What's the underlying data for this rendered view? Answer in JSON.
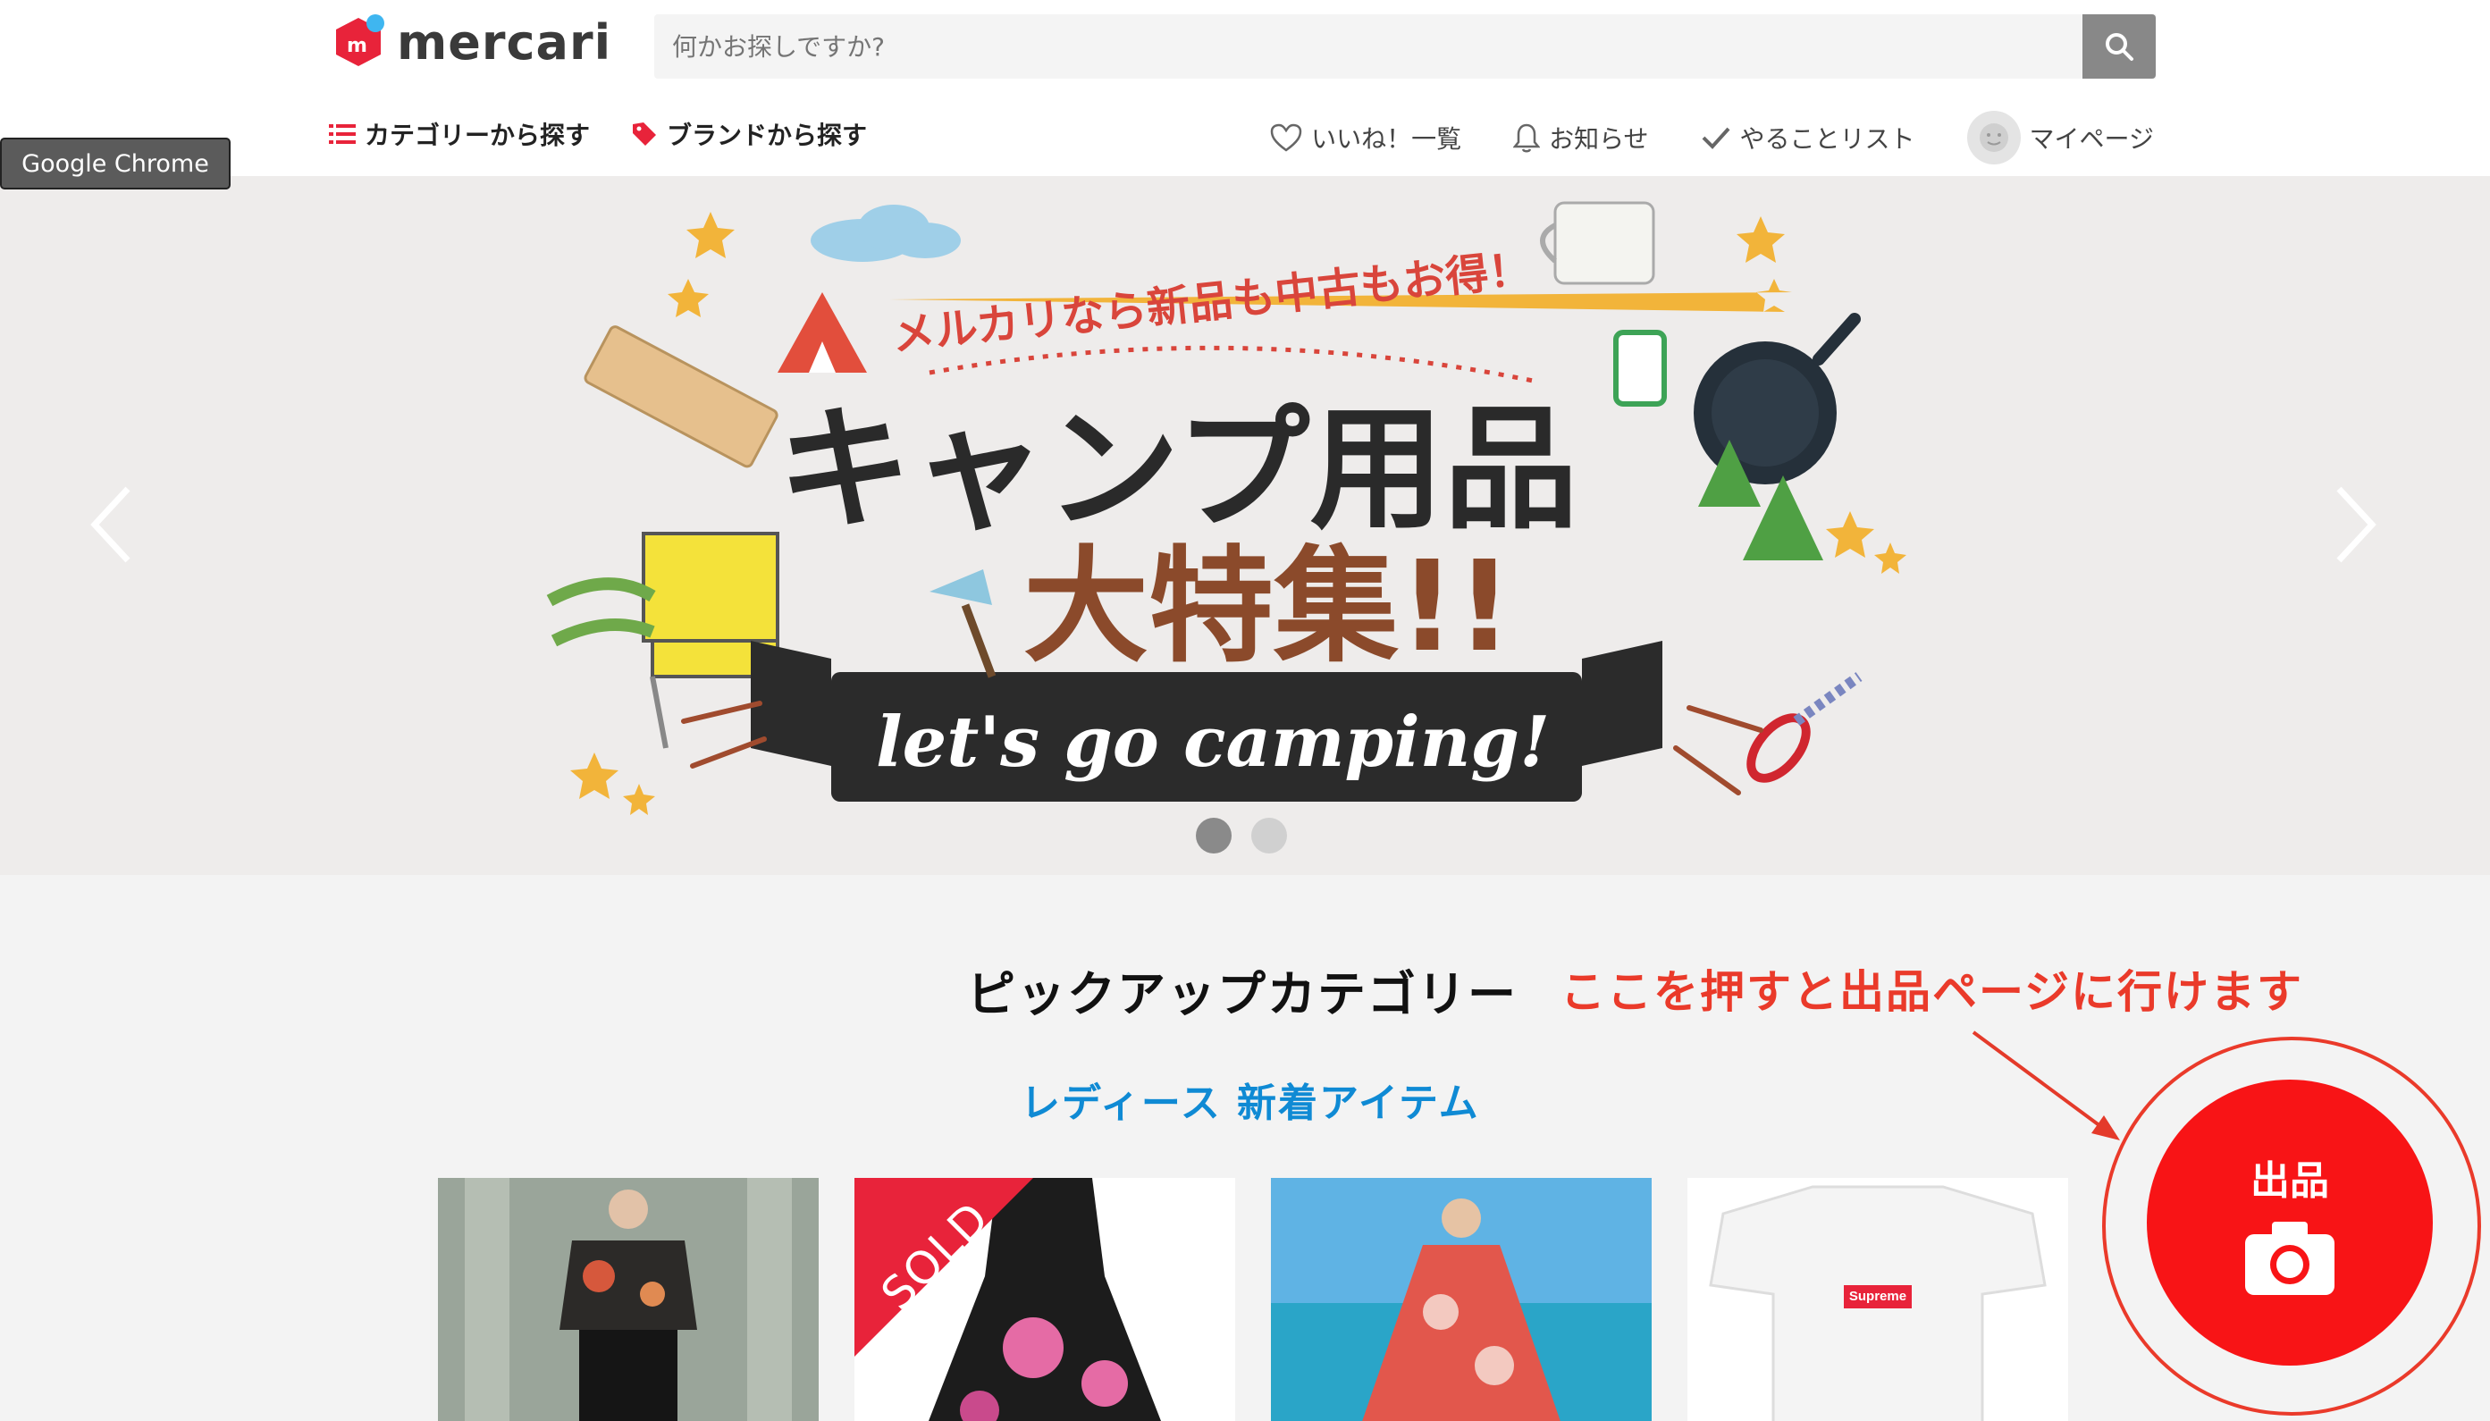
{
  "header": {
    "logo_text": "mercari",
    "search_placeholder": "何かお探しですか?",
    "nav_left": [
      {
        "label": "カテゴリーから探す",
        "icon": "list-icon"
      },
      {
        "label": "ブランドから探す",
        "icon": "tag-icon"
      }
    ],
    "nav_right": [
      {
        "label": "いいね！一覧",
        "icon": "heart-icon"
      },
      {
        "label": "お知らせ",
        "icon": "bell-icon"
      },
      {
        "label": "やることリスト",
        "icon": "check-icon"
      },
      {
        "label": "マイページ",
        "icon": "avatar-icon"
      }
    ]
  },
  "tooltip": "Google Chrome",
  "banner": {
    "headline_top": "メルカリなら新品も中古もお得！",
    "headline_main": "キャンプ用品",
    "headline_sub": "大特集!!",
    "ribbon": "let's go camping!",
    "slide_count": 2,
    "active_slide": 1
  },
  "pickup": {
    "title": "ピックアップカテゴリー",
    "subtitle": "レディース 新着アイテム",
    "items": [
      {
        "sold": false,
        "sold_label": ""
      },
      {
        "sold": true,
        "sold_label": "SOLD"
      },
      {
        "sold": false,
        "sold_label": ""
      },
      {
        "sold": false,
        "sold_label": "",
        "brand_label": "Supreme"
      }
    ]
  },
  "annotation": "ここを押すと出品ページに行けます",
  "sell_button": {
    "label": "出品",
    "icon": "camera-icon"
  },
  "colors": {
    "brand_red": "#f81416",
    "annotation_red": "#ea3a2a",
    "link_blue": "#0f8ad4"
  }
}
